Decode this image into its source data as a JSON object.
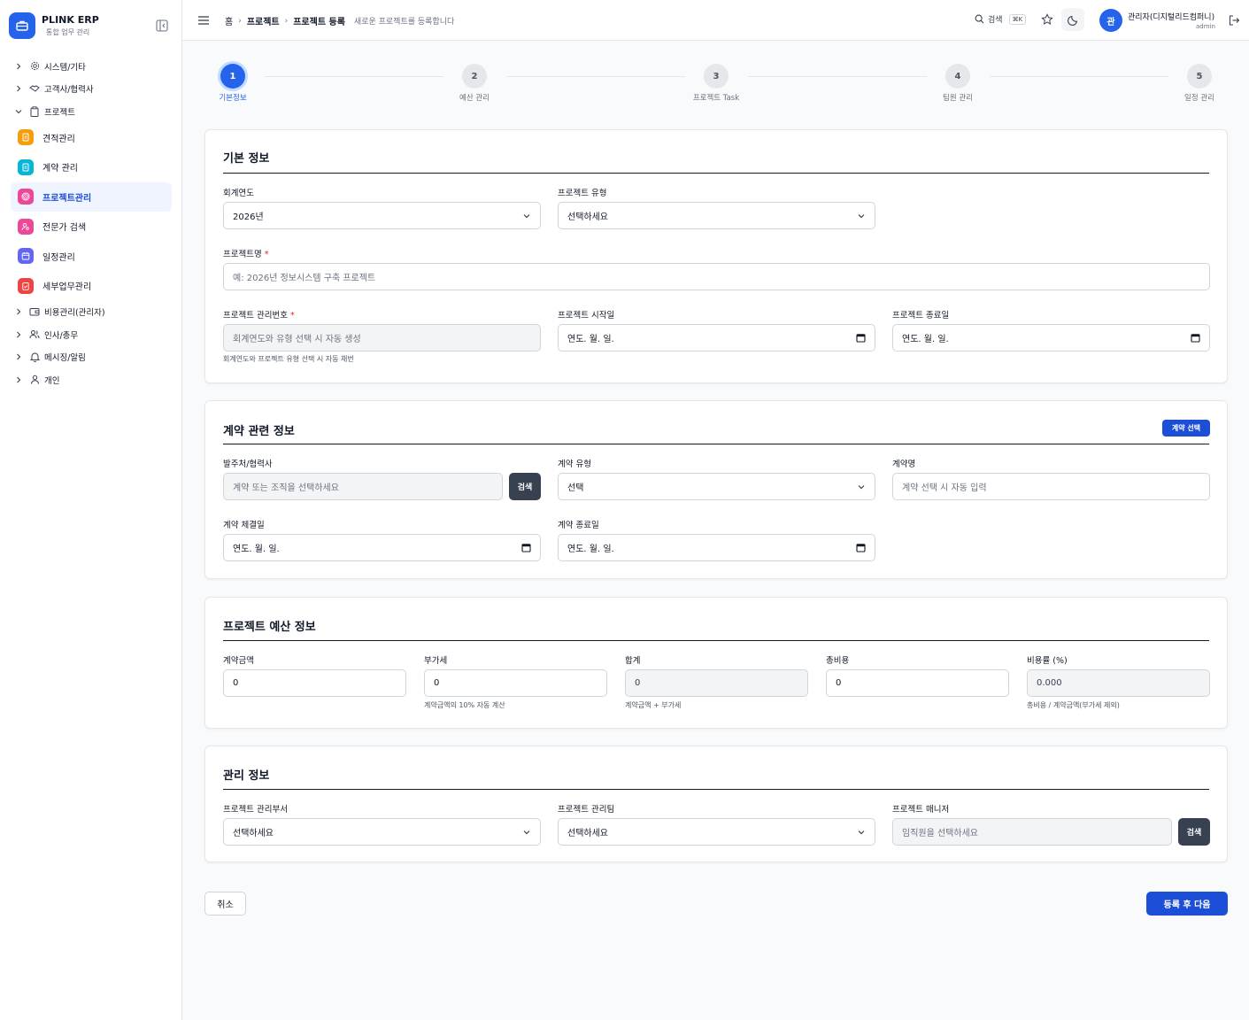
{
  "brand": {
    "title": "PLINK ERP",
    "subtitle": "통합 업무 관리"
  },
  "sidebar": {
    "groups_top": [
      {
        "label": "시스템/기타",
        "icon": "gear-icon"
      },
      {
        "label": "고객사/협력사",
        "icon": "handshake-icon"
      },
      {
        "label": "프로젝트",
        "icon": "clipboard-icon"
      }
    ],
    "project_items": [
      {
        "label": "견적관리",
        "icon": "quote-doc-icon",
        "color": "#f59e0b"
      },
      {
        "label": "계약 관리",
        "icon": "contract-doc-icon",
        "color": "#06b6d4"
      },
      {
        "label": "프로젝트관리",
        "icon": "target-icon",
        "color": "#ec4899"
      },
      {
        "label": "전문가 검색",
        "icon": "user-search-icon",
        "color": "#ec4899"
      },
      {
        "label": "일정관리",
        "icon": "calendar-icon",
        "color": "#6366f1"
      },
      {
        "label": "세부업무관리",
        "icon": "clipboard-check-icon",
        "color": "#ef4444"
      }
    ],
    "groups_bottom": [
      {
        "label": "비용관리(관리자)",
        "icon": "wallet-icon"
      },
      {
        "label": "인사/총무",
        "icon": "users-icon"
      },
      {
        "label": "메시징/알림",
        "icon": "bell-icon"
      },
      {
        "label": "개인",
        "icon": "user-icon"
      }
    ]
  },
  "header": {
    "breadcrumb": [
      "홈",
      "프로젝트",
      "프로젝트 등록"
    ],
    "description": "새로운 프로젝트를 등록합니다",
    "search_label": "검색",
    "search_shortcut": "⌘K",
    "avatar_initial": "관",
    "user_name": "관리자(디지털리드컴퍼니)",
    "user_role": "admin"
  },
  "steps": [
    {
      "number": "1",
      "label": "기본정보",
      "active": true
    },
    {
      "number": "2",
      "label": "예산 관리",
      "active": false
    },
    {
      "number": "3",
      "label": "프로젝트 Task",
      "active": false
    },
    {
      "number": "4",
      "label": "팀원 관리",
      "active": false
    },
    {
      "number": "5",
      "label": "일정 관리",
      "active": false
    }
  ],
  "basic": {
    "title": "기본 정보",
    "fiscal_year_label": "회계연도",
    "fiscal_year_value": "2026년",
    "type_label": "프로젝트 유형",
    "type_value": "선택하세요",
    "name_label": "프로젝트명",
    "name_placeholder": "예: 2026년 정보시스템 구축 프로젝트",
    "mgmt_no_label": "프로젝트 관리번호",
    "mgmt_no_placeholder": "회계연도와 유형 선택 시 자동 생성",
    "mgmt_no_hint": "회계연도와 프로젝트 유형 선택 시 자동 채번",
    "start_label": "프로젝트 시작일",
    "start_value": "연도. 월. 일.",
    "end_label": "프로젝트 종료일",
    "end_value": "연도. 월. 일."
  },
  "contract": {
    "title": "계약 관련 정보",
    "select_button": "계약 선택",
    "client_label": "발주처/협력사",
    "client_placeholder": "계약 또는 조직을 선택하세요",
    "client_search": "검색",
    "type_label": "계약 유형",
    "type_value": "선택",
    "name_label": "계약명",
    "name_placeholder": "계약 선택 시 자동 입력",
    "sign_label": "계약 체결일",
    "sign_value": "연도. 월. 일.",
    "end_label": "계약 종료일",
    "end_value": "연도. 월. 일."
  },
  "budget": {
    "title": "프로젝트 예산 정보",
    "amount_label": "계약금액",
    "amount_value": "0",
    "vat_label": "부가세",
    "vat_value": "0",
    "vat_hint": "계약금액의 10% 자동 계산",
    "total_label": "합계",
    "total_value": "0",
    "total_hint": "계약금액 + 부가세",
    "cost_label": "총비용",
    "cost_value": "0",
    "ratio_label": "비용률 (%)",
    "ratio_value": "0.000",
    "ratio_hint": "총비용 / 계약금액(부가세 제외)"
  },
  "management": {
    "title": "관리 정보",
    "dept_label": "프로젝트 관리부서",
    "dept_value": "선택하세요",
    "team_label": "프로젝트 관리팀",
    "team_value": "선택하세요",
    "manager_label": "프로젝트 매니저",
    "manager_placeholder": "임직원을 선택하세요",
    "manager_search": "검색"
  },
  "actions": {
    "cancel": "취소",
    "next": "등록 후 다음"
  },
  "colors": {
    "primary": "#2563eb",
    "primary_dark": "#1d4ed8",
    "active_bg": "#eff4ff",
    "dark_button": "#374151"
  }
}
